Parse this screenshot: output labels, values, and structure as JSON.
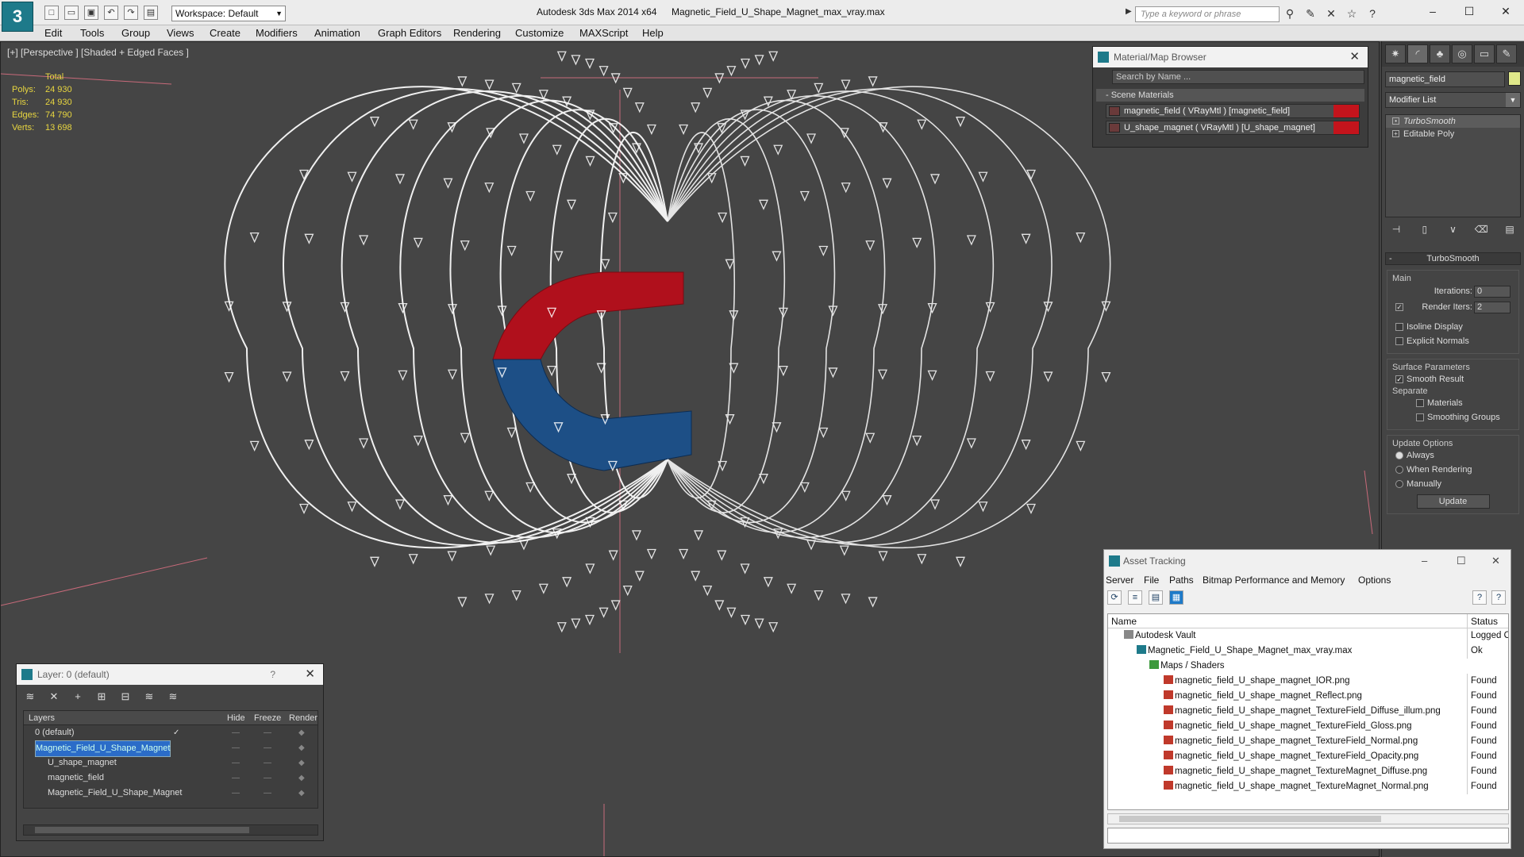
{
  "app": {
    "title": "Autodesk 3ds Max  2014 x64",
    "file": "Magnetic_Field_U_Shape_Magnet_max_vray.max",
    "logo_letter": "3",
    "workspace": "Workspace: Default",
    "search_placeholder": "Type a keyword or phrase"
  },
  "menu": [
    "Edit",
    "Tools",
    "Group",
    "Views",
    "Create",
    "Modifiers",
    "Animation",
    "Graph Editors",
    "Rendering",
    "Customize",
    "MAXScript",
    "Help"
  ],
  "viewport": {
    "label": "[+] [Perspective ] [Shaded + Edged Faces ]",
    "stats": {
      "total_label": "Total",
      "rows": [
        {
          "key": "Polys:",
          "value": "24 930"
        },
        {
          "key": "Tris:",
          "value": "24 930"
        },
        {
          "key": "Edges:",
          "value": "74 790"
        },
        {
          "key": "Verts:",
          "value": "13 698"
        }
      ]
    },
    "colors": {
      "magnet_red": "#b0101c",
      "magnet_blue": "#1d4f86",
      "wire": "#ffffff",
      "background": "#454545"
    }
  },
  "material_browser": {
    "title": "Material/Map Browser",
    "search": "Search by Name ...",
    "section": "- Scene Materials",
    "materials": [
      {
        "label": "magnetic_field  ( VRayMtl ) [magnetic_field]",
        "swatch": "#c4141c"
      },
      {
        "label": "U_shape_magnet  ( VRayMtl ) [U_shape_magnet]",
        "swatch": "#c4141c"
      }
    ]
  },
  "command_panel": {
    "object_name": "magnetic_field",
    "object_color": "#dfe88a",
    "modifier_list": "Modifier List",
    "stack": [
      {
        "label": "TurboSmooth",
        "selected": true
      },
      {
        "label": "Editable Poly",
        "selected": false
      }
    ],
    "rollout_title": "TurboSmooth",
    "main_label": "Main",
    "iterations_label": "Iterations:",
    "iterations_value": "0",
    "render_iters_label": "Render Iters:",
    "render_iters_value": "2",
    "isoline_label": "Isoline Display",
    "explicit_label": "Explicit Normals",
    "surface_label": "Surface Parameters",
    "smooth_label": "Smooth Result",
    "separate_label": "Separate",
    "materials_label": "Materials",
    "smoothing_label": "Smoothing Groups",
    "update_options_label": "Update Options",
    "always_label": "Always",
    "when_rendering_label": "When Rendering",
    "manually_label": "Manually",
    "update_button": "Update"
  },
  "layer_window": {
    "title": "Layer: 0 (default)",
    "help": "?",
    "columns": {
      "layers": "Layers",
      "hide": "Hide",
      "freeze": "Freeze",
      "render": "Render"
    },
    "rows": [
      {
        "name": "0 (default)",
        "indent": 0,
        "selected": false,
        "check": "✓"
      },
      {
        "name": "Magnetic_Field_U_Shape_Magnet",
        "indent": 0,
        "selected": true,
        "check": ""
      },
      {
        "name": "U_shape_magnet",
        "indent": 1,
        "selected": false,
        "check": ""
      },
      {
        "name": "magnetic_field",
        "indent": 1,
        "selected": false,
        "check": ""
      },
      {
        "name": "Magnetic_Field_U_Shape_Magnet",
        "indent": 1,
        "selected": false,
        "check": ""
      }
    ]
  },
  "asset_tracking": {
    "title": "Asset Tracking",
    "menu": [
      "Server",
      "File",
      "Paths",
      "Bitmap Performance and Memory",
      "Options"
    ],
    "col_name": "Name",
    "col_status": "Status",
    "rows": [
      {
        "name": "Autodesk Vault",
        "status": "Logged O",
        "icon": "vault",
        "level": 1
      },
      {
        "name": "Magnetic_Field_U_Shape_Magnet_max_vray.max",
        "status": "Ok",
        "icon": "max",
        "level": 2
      },
      {
        "name": "Maps / Shaders",
        "status": "",
        "icon": "folder",
        "level": 3
      },
      {
        "name": "magnetic_field_U_shape_magnet_IOR.png",
        "status": "Found",
        "icon": "png",
        "level": 4
      },
      {
        "name": "magnetic_field_U_shape_magnet_Reflect.png",
        "status": "Found",
        "icon": "png",
        "level": 4
      },
      {
        "name": "magnetic_field_U_shape_magnet_TextureField_Diffuse_illum.png",
        "status": "Found",
        "icon": "png",
        "level": 4
      },
      {
        "name": "magnetic_field_U_shape_magnet_TextureField_Gloss.png",
        "status": "Found",
        "icon": "png",
        "level": 4
      },
      {
        "name": "magnetic_field_U_shape_magnet_TextureField_Normal.png",
        "status": "Found",
        "icon": "png",
        "level": 4
      },
      {
        "name": "magnetic_field_U_shape_magnet_TextureField_Opacity.png",
        "status": "Found",
        "icon": "png",
        "level": 4
      },
      {
        "name": "magnetic_field_U_shape_magnet_TextureMagnet_Diffuse.png",
        "status": "Found",
        "icon": "png",
        "level": 4
      },
      {
        "name": "magnetic_field_U_shape_magnet_TextureMagnet_Normal.png",
        "status": "Found",
        "icon": "png",
        "level": 4
      }
    ]
  }
}
